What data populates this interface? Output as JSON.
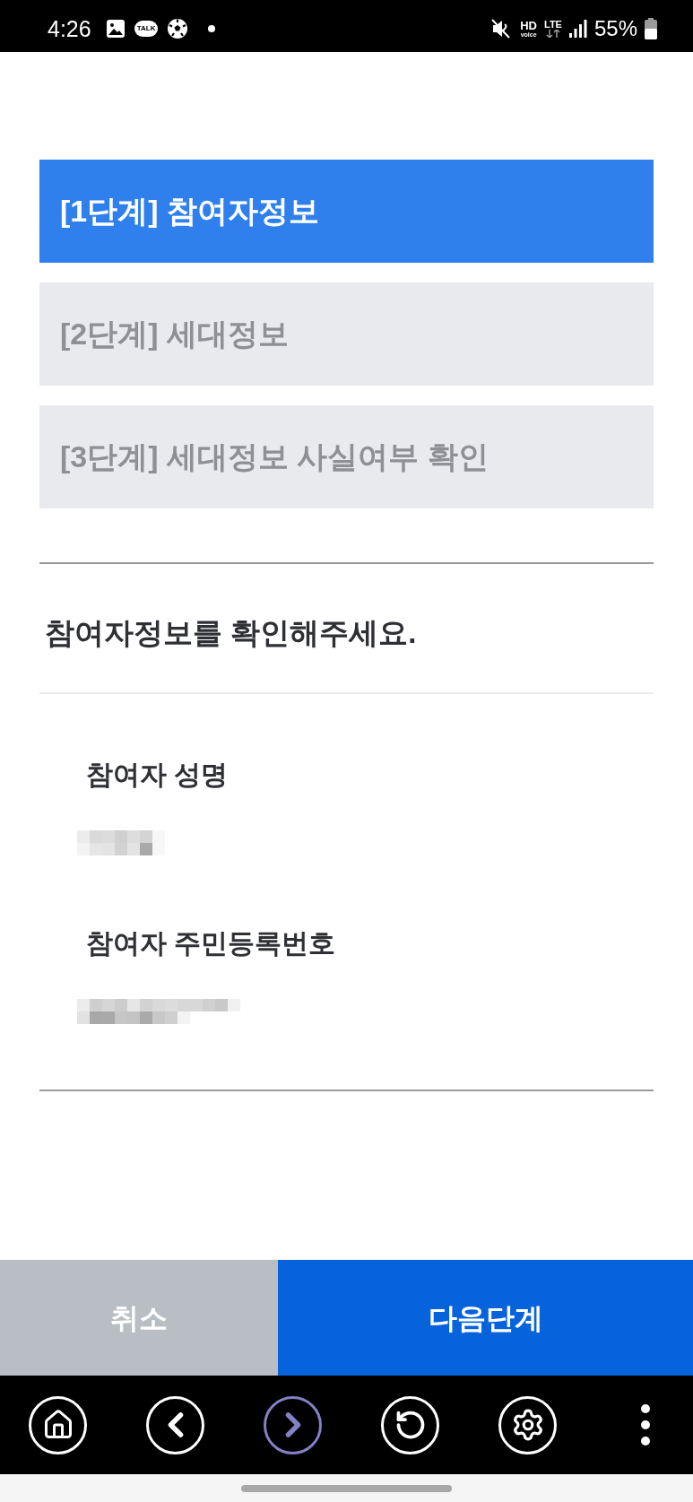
{
  "status_bar": {
    "time": "4:26",
    "talk_badge": "TALK",
    "hd_label": "HD",
    "voice_label": "voice",
    "network_label": "LTE",
    "battery": "55%"
  },
  "steps": [
    {
      "label": "[1단계] 참여자정보",
      "selected": true
    },
    {
      "label": "[2단계] 세대정보",
      "selected": false
    },
    {
      "label": "[3단계] 세대정보 사실여부 확인",
      "selected": false
    }
  ],
  "section": {
    "title": "참여자정보를 확인해주세요.",
    "fields": [
      {
        "label": "참여자 성명",
        "redacted": true
      },
      {
        "label": "참여자 주민등록번호",
        "redacted": true
      }
    ]
  },
  "buttons": [
    {
      "label": "취소",
      "kind": "secondary"
    },
    {
      "label": "다음단계",
      "kind": "primary"
    }
  ],
  "nav_bar": [
    {
      "kind": "home",
      "highlighted": false
    },
    {
      "kind": "back",
      "highlighted": false
    },
    {
      "kind": "forward",
      "highlighted": true
    },
    {
      "kind": "refresh",
      "highlighted": false
    },
    {
      "kind": "settings",
      "highlighted": false
    },
    {
      "kind": "more",
      "highlighted": false
    }
  ]
}
